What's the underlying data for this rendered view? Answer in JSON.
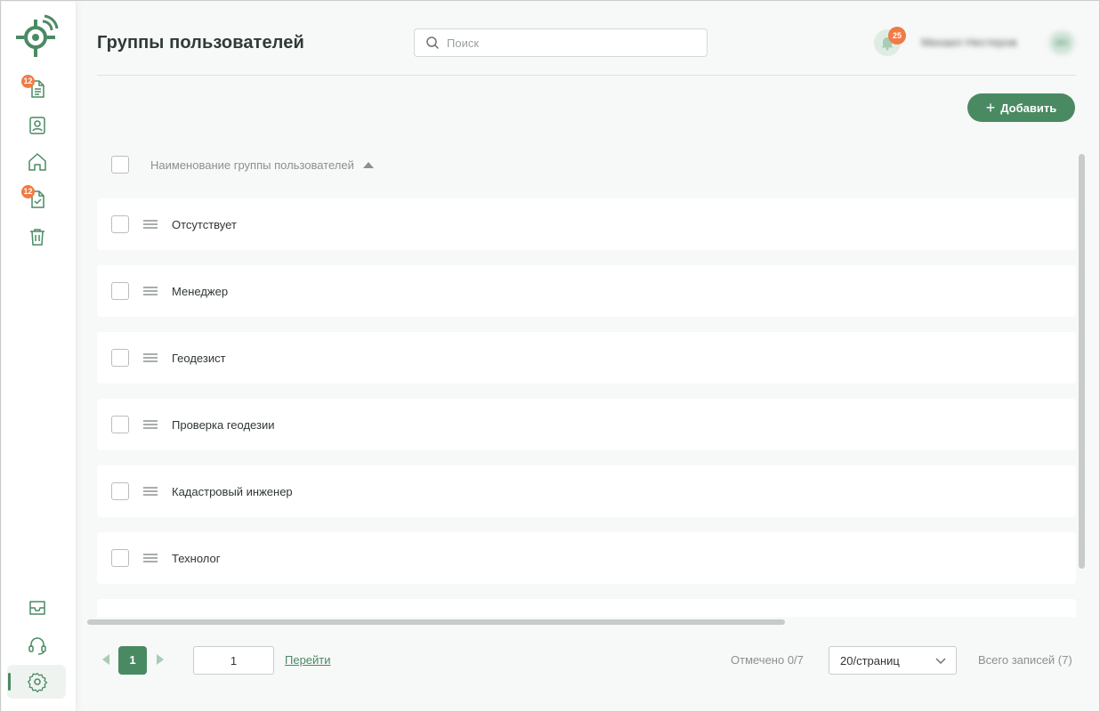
{
  "header": {
    "title": "Группы пользователей",
    "search_placeholder": "Поиск",
    "notifications_count": "25",
    "user_name": "Михаил Нестеров",
    "user_initials": "МН"
  },
  "sidebar": {
    "items": [
      {
        "icon": "document-list-icon",
        "badge": "12"
      },
      {
        "icon": "contact-card-icon",
        "badge": ""
      },
      {
        "icon": "home-icon",
        "badge": ""
      },
      {
        "icon": "document-check-icon",
        "badge": "12"
      },
      {
        "icon": "trash-icon",
        "badge": ""
      },
      {
        "icon": "inbox-icon",
        "badge": ""
      },
      {
        "icon": "headset-icon",
        "badge": ""
      },
      {
        "icon": "gear-icon",
        "badge": "",
        "active": true
      }
    ]
  },
  "toolbar": {
    "add_label": "Добавить"
  },
  "table": {
    "column_header": "Наименование группы пользователей",
    "rows": [
      "Отсутствует",
      "Менеджер",
      "Геодезист",
      "Проверка геодезии",
      "Кадастровый инженер",
      "Технолог"
    ]
  },
  "pagination": {
    "current_page": "1",
    "goto_value": "1",
    "goto_label": "Перейти",
    "marked": "Отмечено 0/7",
    "per_page": "20/страниц",
    "total": "Всего записей (7)"
  },
  "colors": {
    "accent": "#4a8a63",
    "badge": "#ef7b45"
  }
}
